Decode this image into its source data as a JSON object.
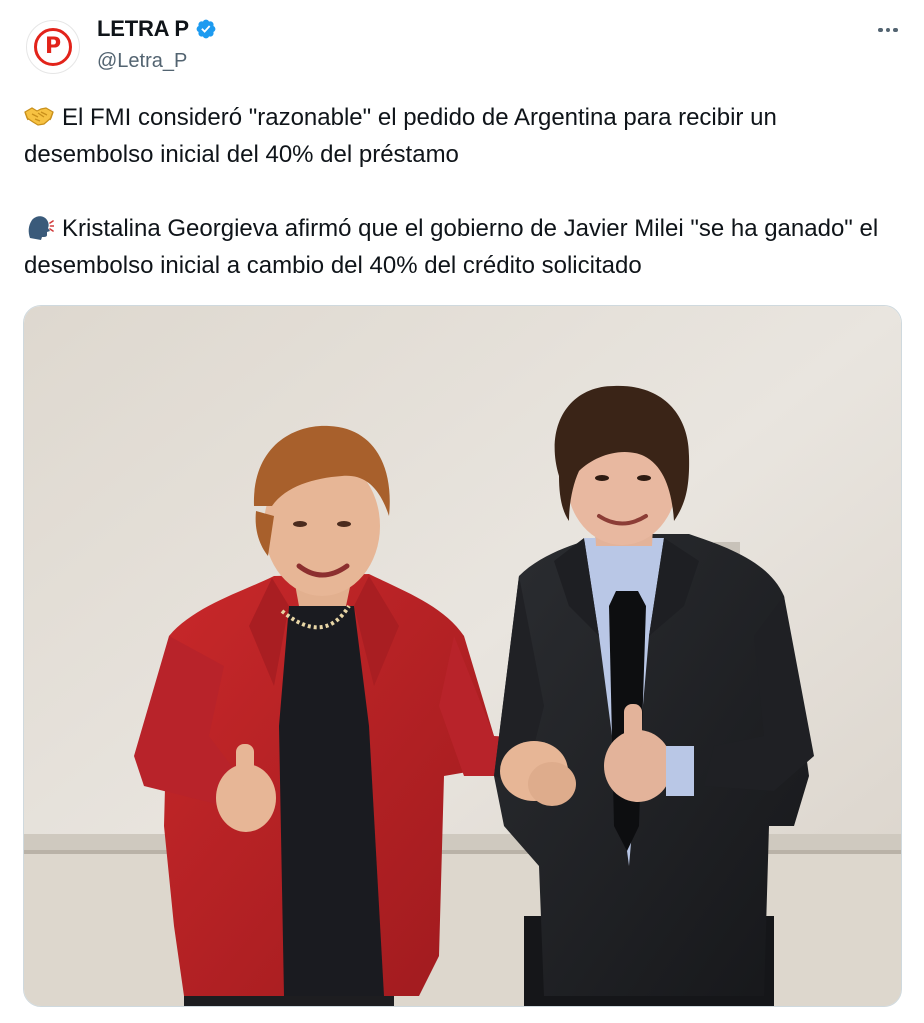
{
  "author": {
    "display_name": "LETRA P",
    "handle": "@Letra_P",
    "verified": true,
    "avatar_letter": "P",
    "avatar_color": "#e2231a"
  },
  "tweet": {
    "paragraphs": [
      {
        "emoji": "handshake-emoji",
        "text": "El FMI consideró \"razonable\" el pedido de Argentina para recibir un desembolso inicial del 40% del préstamo"
      },
      {
        "emoji": "speaking-head-emoji",
        "text": "Kristalina Georgieva afirmó que el gobierno de Javier Milei \"se ha ganado\" el desembolso inicial a cambio del 40% del crédito solicitado"
      }
    ]
  },
  "icons": {
    "verified": "verified-badge-icon",
    "more": "more-options-icon"
  },
  "colors": {
    "text": "#0f1419",
    "secondary": "#536471",
    "verified_blue": "#1d9bf0",
    "border": "#cfd9de"
  }
}
